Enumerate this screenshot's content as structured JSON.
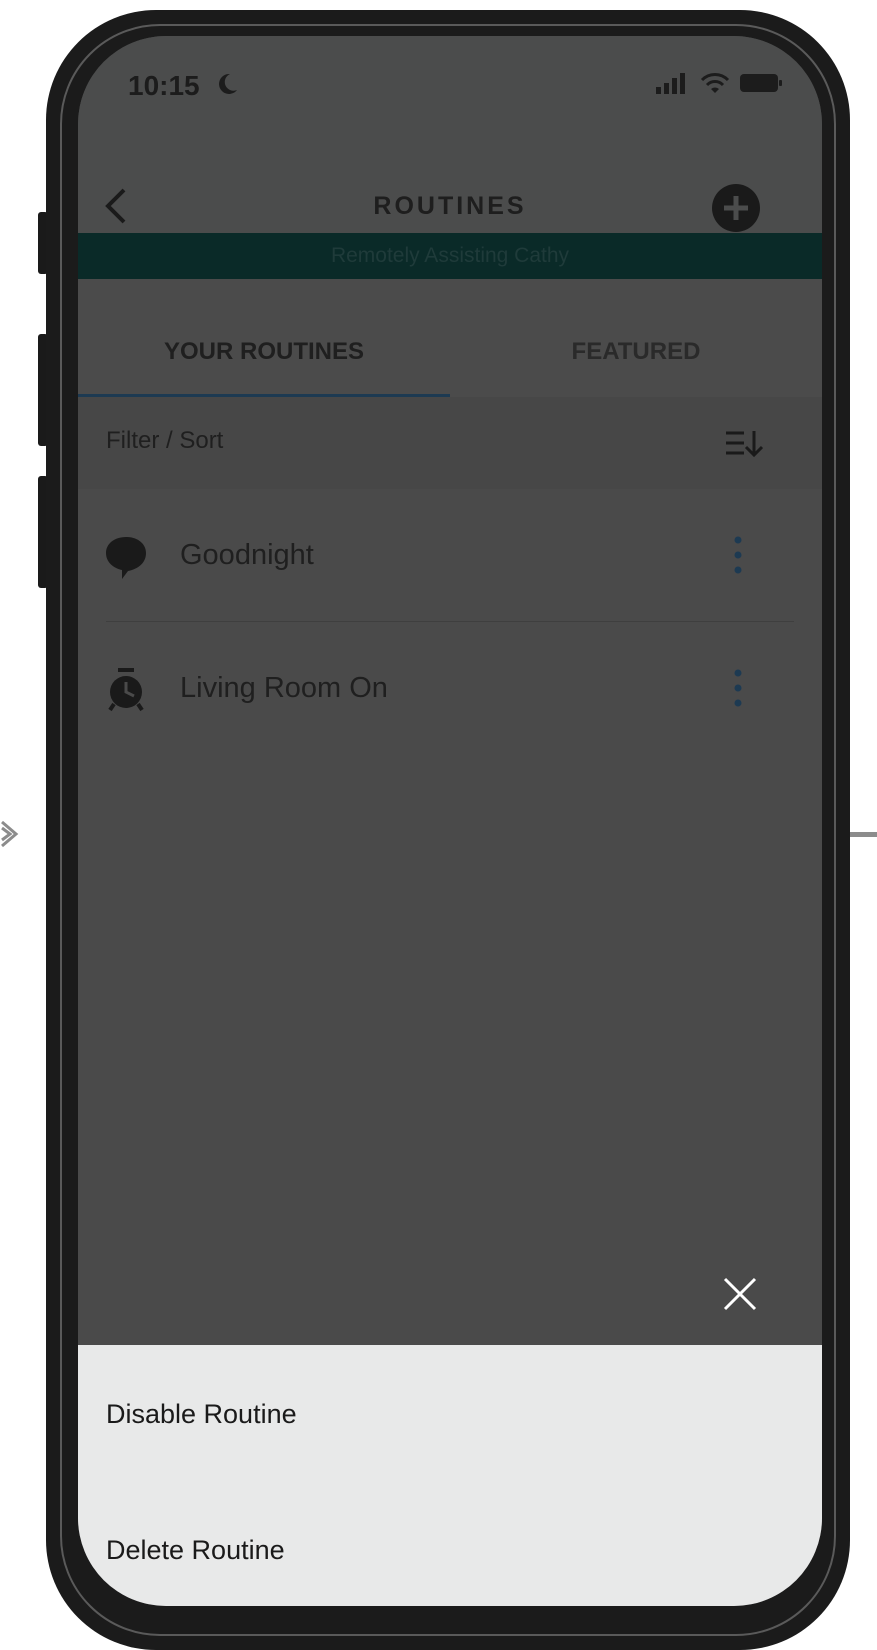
{
  "status_bar": {
    "time": "10:15"
  },
  "header": {
    "title": "ROUTINES"
  },
  "banner": {
    "text": "Remotely Assisting Cathy"
  },
  "tabs": [
    {
      "label": "YOUR ROUTINES",
      "active": true
    },
    {
      "label": "FEATURED",
      "active": false
    }
  ],
  "filter": {
    "label": "Filter / Sort"
  },
  "routines": [
    {
      "name": "Goodnight",
      "icon": "speech-bubble-icon"
    },
    {
      "name": "Living Room On",
      "icon": "alarm-clock-icon"
    }
  ],
  "sheet": {
    "disable_label": "Disable Routine",
    "delete_label": "Delete Routine"
  },
  "colors": {
    "overlay": "#4a4a4a",
    "banner": "#0a2a28",
    "tab_underline": "#1d3a52",
    "more_dots": "#1d3a52",
    "sheet": "#e8e9e9"
  }
}
